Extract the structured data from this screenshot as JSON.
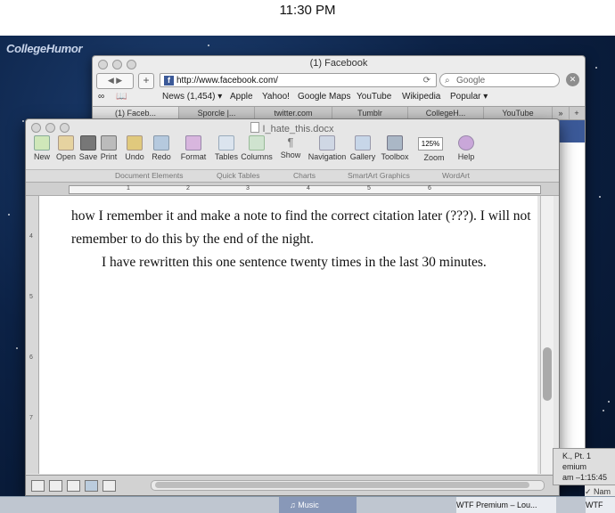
{
  "clock": {
    "time": "11:30 PM"
  },
  "watermark": "CollegeHumor",
  "browser": {
    "title": "(1) Facebook",
    "url": "http://www.facebook.com/",
    "search_placeholder": "Google",
    "bookmarks": [
      "News (1,454) ▾",
      "Apple",
      "Yahoo!",
      "Google Maps",
      "YouTube",
      "Wikipedia",
      "Popular ▾"
    ],
    "tabs": [
      "(1) Faceb...",
      "Sporcle |...",
      "twitter.com",
      "Tumblr",
      "CollegeH...",
      "YouTube"
    ],
    "tab_more": "»",
    "tab_add": "+"
  },
  "word": {
    "title": "I_hate_this.docx",
    "ribbon": [
      "New",
      "Open",
      "Save",
      "Print",
      "Undo",
      "Redo",
      "Format",
      "Tables",
      "Columns",
      "Show",
      "Navigation",
      "Gallery",
      "Toolbox",
      "Zoom",
      "Help"
    ],
    "zoom_value": "125%",
    "sub_tabs": [
      "Document Elements",
      "Quick Tables",
      "Charts",
      "SmartArt Graphics",
      "WordArt"
    ],
    "ruler_numbers": [
      "1",
      "2",
      "3",
      "4",
      "5",
      "6"
    ],
    "vruler_numbers": [
      "4",
      "5",
      "6",
      "7"
    ],
    "paragraph1": "how I remember it and make a note to find the correct citation later (???). I will not remember to do this by the end of the night.",
    "paragraph2": "I have rewritten this one sentence twenty times in the last 30 minutes."
  },
  "itunes": {
    "line1": "K., Pt. 1",
    "line2": "emium",
    "line3": "am   –1:15:45"
  },
  "menubar_check": "✓ Nam",
  "dock": {
    "music": "Music",
    "now_playing1": "WTF Premium – Lou...",
    "now_playing2": "WTF"
  }
}
